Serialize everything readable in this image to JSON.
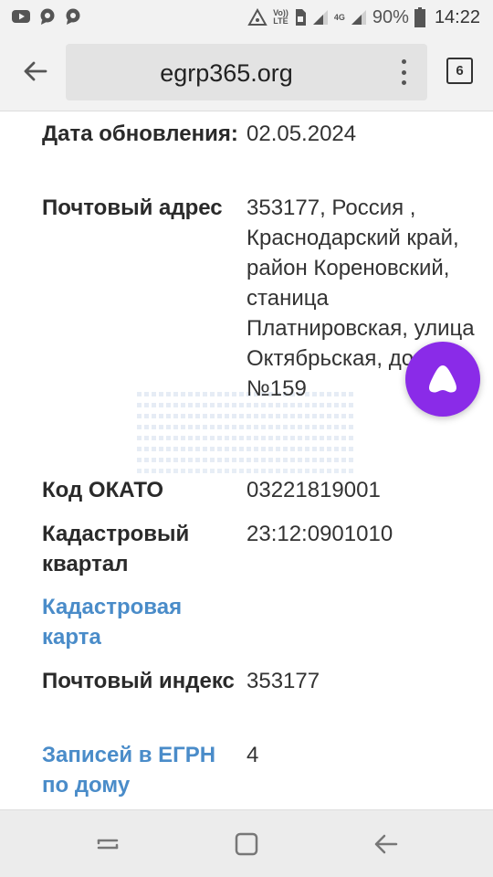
{
  "status_bar": {
    "left_icons": [
      "youtube-icon",
      "chat-bubble-icon",
      "chat-bubble-icon"
    ],
    "volte_top": "Vo))",
    "volte_bottom": "LTE",
    "network_type": "4G",
    "battery_percent": "90%",
    "battery_level": 0.9,
    "time": "14:22"
  },
  "browser": {
    "url": "egrp365.org",
    "tab_count": "6"
  },
  "details": {
    "rows": [
      {
        "label": "Дата обновления:",
        "value": "02.05.2024"
      },
      {
        "label": "Почтовый адрес",
        "value": "353177, Россия , Краснодарский край, район Кореновский, станица Платнировская, улица Октябрьская, дом №159"
      },
      {
        "label": "Код ОКАТО",
        "value": "03221819001"
      },
      {
        "label": "Кадастровый квартал",
        "value": "23:12:0901010"
      },
      {
        "label": "Кадастровая карта",
        "value": ""
      },
      {
        "label": "Почтовый индекс",
        "value": "353177"
      },
      {
        "label": "Записей в ЕГРН по дому",
        "value": "4"
      }
    ]
  },
  "colors": {
    "link": "#4a8cc9",
    "assistant": "#8a2be8",
    "toolbar_bg": "#f2f2f2"
  }
}
